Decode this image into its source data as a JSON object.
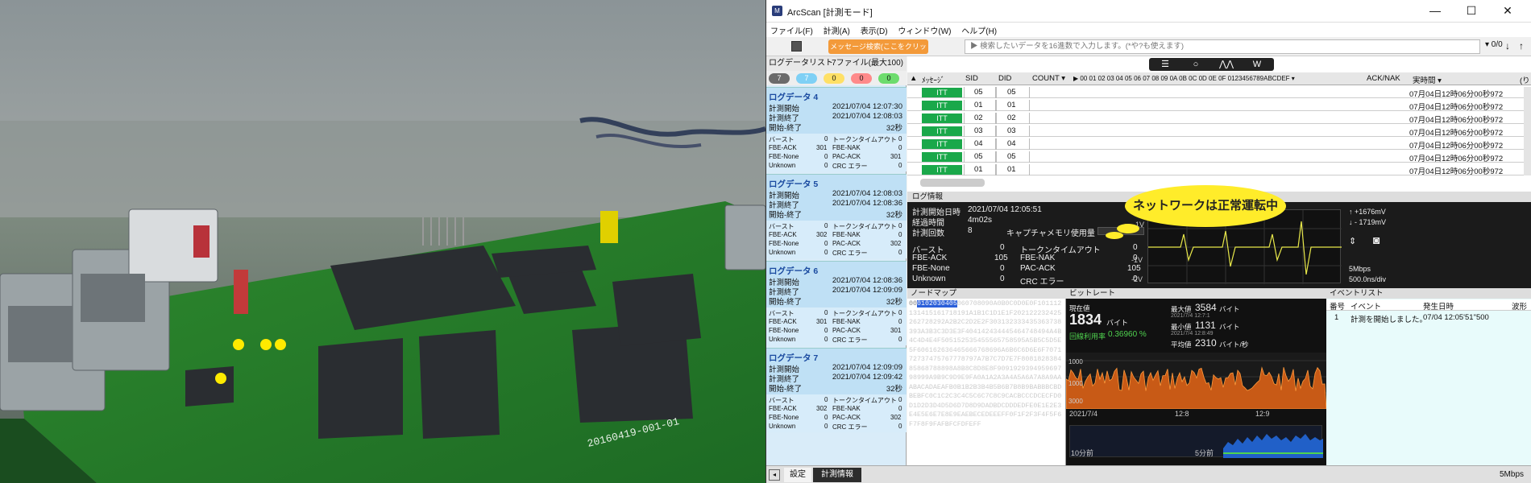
{
  "window": {
    "title": "ArcScan [計測モード]",
    "app_icon": "ArcScan-icon",
    "minimize": "—",
    "maximize": "☐",
    "close": "✕"
  },
  "menu": [
    "ファイル(F)",
    "計測(A)",
    "表示(D)",
    "ウィンドウ(W)",
    "ヘルプ(H)"
  ],
  "toolbar": {
    "message_button": "メッセージ検索(ここをクリックしてください)",
    "search_placeholder": "▶ 検索したいデータを16進数で入力します。(*や?も使えます)",
    "counter": "▾ 0/0"
  },
  "photo": {
    "board_label": "20160419-001-01"
  },
  "log_list": {
    "title": "ログデータリスト",
    "file_count": "7ファイル(最大100)",
    "badges": [
      {
        "value": "7",
        "color": "#6b6b6b"
      },
      {
        "value": "7",
        "color": "#7fd0f5"
      },
      {
        "value": "0",
        "color": "#ffe066"
      },
      {
        "value": "0",
        "color": "#ff8a8a"
      },
      {
        "value": "0",
        "color": "#6ddc6d"
      }
    ],
    "blocks": [
      {
        "title": "ログデータ 4",
        "start_label": "計測開始",
        "start": "2021/07/04 12:07:30",
        "end_label": "計測終了",
        "end": "2021/07/04 12:08:03",
        "dur_label": "開始-終了",
        "duration": "32秒",
        "burst_label": "バースト",
        "burst": "0",
        "timeout_label": "トークンタイムアウト",
        "timeout": "0",
        "fbe_ack_label": "FBE-ACK",
        "fbe_ack": "301",
        "fbe_nak_label": "FBE-NAK",
        "fbe_nak": "0",
        "fbe_none_label": "FBE-None",
        "fbe_none": "0",
        "pac_ack_label": "PAC-ACK",
        "pac_ack": "301",
        "unknown_label": "Unknown",
        "unknown": "0",
        "crc_label": "CRC エラー",
        "crc": "0"
      },
      {
        "title": "ログデータ 5",
        "start_label": "計測開始",
        "start": "2021/07/04 12:08:03",
        "end_label": "計測終了",
        "end": "2021/07/04 12:08:36",
        "dur_label": "開始-終了",
        "duration": "32秒",
        "burst_label": "バースト",
        "burst": "0",
        "timeout_label": "トークンタイムアウト",
        "timeout": "0",
        "fbe_ack_label": "FBE-ACK",
        "fbe_ack": "302",
        "fbe_nak_label": "FBE-NAK",
        "fbe_nak": "0",
        "fbe_none_label": "FBE-None",
        "fbe_none": "0",
        "pac_ack_label": "PAC-ACK",
        "pac_ack": "302",
        "unknown_label": "Unknown",
        "unknown": "0",
        "crc_label": "CRC エラー",
        "crc": "0"
      },
      {
        "title": "ログデータ 6",
        "start_label": "計測開始",
        "start": "2021/07/04 12:08:36",
        "end_label": "計測終了",
        "end": "2021/07/04 12:09:09",
        "dur_label": "開始-終了",
        "duration": "32秒",
        "burst_label": "バースト",
        "burst": "0",
        "timeout_label": "トークンタイムアウト",
        "timeout": "0",
        "fbe_ack_label": "FBE-ACK",
        "fbe_ack": "301",
        "fbe_nak_label": "FBE-NAK",
        "fbe_nak": "0",
        "fbe_none_label": "FBE-None",
        "fbe_none": "0",
        "pac_ack_label": "PAC-ACK",
        "pac_ack": "301",
        "unknown_label": "Unknown",
        "unknown": "0",
        "crc_label": "CRC エラー",
        "crc": "0"
      },
      {
        "title": "ログデータ 7",
        "start_label": "計測開始",
        "start": "2021/07/04 12:09:09",
        "end_label": "計測終了",
        "end": "2021/07/04 12:09:42",
        "dur_label": "開始-終了",
        "duration": "32秒",
        "burst_label": "バースト",
        "burst": "0",
        "timeout_label": "トークンタイムアウト",
        "timeout": "0",
        "fbe_ack_label": "FBE-ACK",
        "fbe_ack": "302",
        "fbe_nak_label": "FBE-NAK",
        "fbe_nak": "0",
        "fbe_none_label": "FBE-None",
        "fbe_none": "0",
        "pac_ack_label": "PAC-ACK",
        "pac_ack": "302",
        "unknown_label": "Unknown",
        "unknown": "0",
        "crc_label": "CRC エラー",
        "crc": "0"
      }
    ]
  },
  "table": {
    "headers": {
      "message": "ﾒｯｾｰｼﾞ",
      "sid": "SID",
      "did": "DID",
      "count": "COUNT ▾",
      "data": "▶ 00 01 02 03 04 05 06 07 08 09 0A 0B 0C 0D 0E 0F  0123456789ABCDEF ▾",
      "acknak": "ACK/NAK",
      "time": "実時間 ▾",
      "more": "(り"
    },
    "rows": [
      {
        "msg": "ITT",
        "sid": "05",
        "did": "05",
        "time": "07月04日12時06分00秒972"
      },
      {
        "msg": "ITT",
        "sid": "01",
        "did": "01",
        "time": "07月04日12時06分00秒972"
      },
      {
        "msg": "ITT",
        "sid": "02",
        "did": "02",
        "time": "07月04日12時06分00秒972"
      },
      {
        "msg": "ITT",
        "sid": "03",
        "did": "03",
        "time": "07月04日12時06分00秒972"
      },
      {
        "msg": "ITT",
        "sid": "04",
        "did": "04",
        "time": "07月04日12時06分00秒972"
      },
      {
        "msg": "ITT",
        "sid": "05",
        "did": "05",
        "time": "07月04日12時06分00秒972"
      },
      {
        "msg": "ITT",
        "sid": "01",
        "did": "01",
        "time": "07月04日12時06分00秒972"
      }
    ]
  },
  "log_info": {
    "title": "ログ情報",
    "start_label": "計測開始日時",
    "start": "2021/07/04 12:05:51",
    "elapsed_label": "経過時間",
    "elapsed": "4m02s",
    "count_label": "計測回数",
    "count": "8",
    "capture_label": "キャプチャメモリ使用量",
    "burst_label": "バースト",
    "burst": "0",
    "timeout_label": "トークンタイムアウト",
    "timeout": "0",
    "fbe_ack_label": "FBE-ACK",
    "fbe_ack": "105",
    "fbe_nak_label": "FBE-NAK",
    "fbe_nak": "0",
    "fbe_none_label": "FBE-None",
    "fbe_none": "0",
    "pac_ack_label": "PAC-ACK",
    "pac_ack": "105",
    "unknown_label": "Unknown",
    "unknown": "0",
    "crc_label": "CRC エラー",
    "crc": "0",
    "callout": "ネットワークは正常運転中",
    "scope_y_labels": [
      "1V",
      "-1V",
      "-2V"
    ],
    "max_v": "↑ +1676mV",
    "min_v": "↓ - 1719mV",
    "rate": "5Mbps",
    "timebase": "500.0ns/div"
  },
  "node_map": {
    "title": "ノードマップ",
    "selected": [
      "01",
      "02",
      "03",
      "04",
      "05"
    ],
    "first_cell": "00"
  },
  "bitrate": {
    "title": "ビットレート",
    "current_label": "現在値",
    "current": "1834",
    "current_unit": "バイト",
    "usage_label": "回線利用率",
    "usage": "0.36960 %",
    "max_label": "最大値",
    "max": "3584",
    "max_unit": "バイト",
    "max_time": "2021/7/4 12:7:1",
    "min_label": "最小値",
    "min": "1131",
    "min_unit": "バイト",
    "min_time": "2021/7/4 12:8:49",
    "avg_label": "平均値",
    "avg": "2310",
    "avg_unit": "バイト/秒",
    "y_labels": [
      "1000",
      "1000",
      "3000"
    ],
    "x_labels": [
      "2021/7/4",
      "12:8",
      "12:9"
    ],
    "bottom_labels": [
      "10分前",
      "5分前"
    ]
  },
  "events": {
    "title": "イベントリスト",
    "headers": [
      "番号",
      "イベント",
      "発生日時",
      "波形"
    ],
    "rows": [
      {
        "no": "1",
        "event": "計測を開始しました。",
        "time": "07/04 12:05'51\"500"
      }
    ]
  },
  "statusbar": {
    "tab1": "設定",
    "tab2": "計測情報",
    "rate": "5Mbps"
  }
}
